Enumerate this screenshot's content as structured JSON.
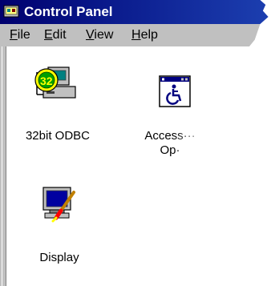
{
  "window": {
    "title": "Control Panel"
  },
  "menu": {
    "file": {
      "underlined": "F",
      "rest": "ile"
    },
    "edit": {
      "underlined": "E",
      "rest": "dit"
    },
    "view": {
      "underlined": "V",
      "rest": "iew"
    },
    "help": {
      "underlined": "H",
      "rest": "elp"
    }
  },
  "items": [
    {
      "name": "32bit-odbc",
      "label": "32bit ODBC"
    },
    {
      "name": "accessibility-options",
      "label_line1": "Access···",
      "label_line2": "Op·"
    },
    {
      "name": "display",
      "label": "Display"
    }
  ],
  "colors": {
    "titlebar_start": "#00006e",
    "titlebar_end": "#1c3fb0",
    "menubar": "#c0c0c0",
    "client": "#ffffff"
  }
}
